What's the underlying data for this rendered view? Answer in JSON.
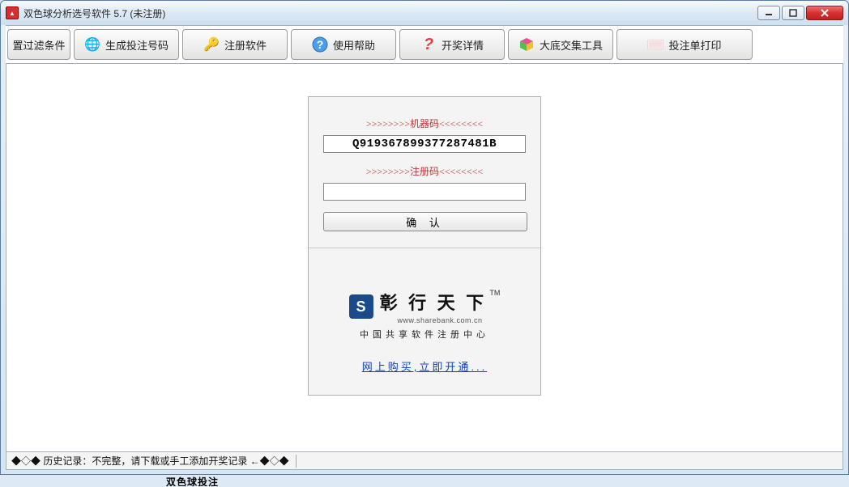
{
  "window": {
    "title": "双色球分析选号软件 5.7  (未注册)"
  },
  "toolbar": {
    "btn1": "置过滤条件",
    "btn2": "生成投注号码",
    "btn3": "注册软件",
    "btn4": "使用帮助",
    "btn5": "开奖详情",
    "btn6": "大底交集工具",
    "btn7": "投注单打印"
  },
  "register": {
    "machine_label": ">>>>>>>>机器码<<<<<<<<",
    "machine_code": "Q919367899377287481B",
    "reg_label": ">>>>>>>>注册码<<<<<<<<",
    "reg_value": "",
    "confirm": "确 认",
    "brand_name": "彰 行 天 下",
    "brand_url": "www.sharebank.com.cn",
    "brand_sub": "中国共享软件注册中心",
    "buy_link": "网上购买,立即开通..."
  },
  "status": {
    "text": "◆◇◆ 历史记录：不完整，请下载或手工添加开奖记录 ←◆◇◆"
  },
  "below": "双色球投注"
}
